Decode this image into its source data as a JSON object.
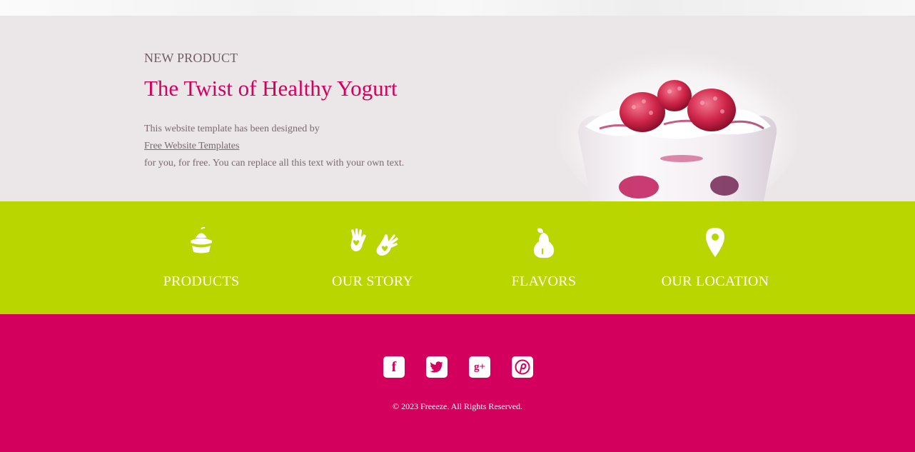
{
  "hero": {
    "label": "NEW PRODUCT",
    "title": "The Twist of Healthy Yogurt",
    "desc_line1": "This website template has been designed by",
    "desc_link": "Free Website Templates",
    "desc_line3": "for you, for free. You can replace all this text with your own text."
  },
  "nav": {
    "items": [
      {
        "label": "PRODUCTS",
        "icon": "cupcake-icon"
      },
      {
        "label": "OUR STORY",
        "icon": "hands-heart-icon"
      },
      {
        "label": "FLAVORS",
        "icon": "pear-icon"
      },
      {
        "label": "OUR LOCATION",
        "icon": "map-pin-icon"
      }
    ]
  },
  "footer": {
    "social": [
      {
        "name": "facebook",
        "glyph": "f"
      },
      {
        "name": "twitter",
        "glyph": "t"
      },
      {
        "name": "google-plus",
        "glyph": "g+"
      },
      {
        "name": "pinterest",
        "glyph": "P"
      }
    ],
    "copyright": "© 2023 Freeeze. All Rights Reserved."
  },
  "colors": {
    "brand_pink": "#d4005e",
    "lime": "#b9d600",
    "hero_bg": "#ebe6e7"
  }
}
